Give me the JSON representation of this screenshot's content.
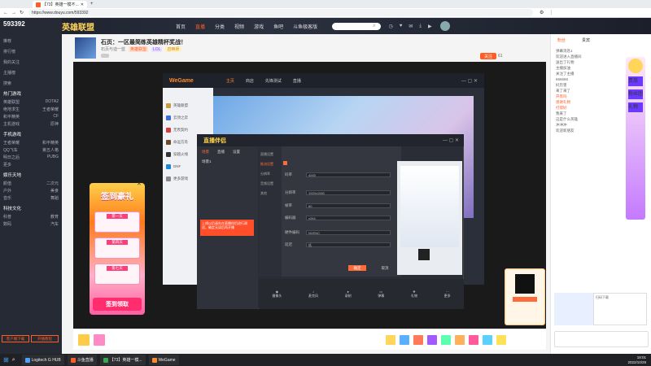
{
  "browser": {
    "tab_title": "【73】英雄一模不...",
    "url": "https://www.douyu.com/593392",
    "page_zoom": "593392"
  },
  "site": {
    "nav": [
      "首页",
      "直播",
      "分类",
      "视频",
      "游戏",
      "鱼吧",
      "斗鱼极客版"
    ],
    "active_nav": "直播"
  },
  "sidebar": {
    "top_items": [
      "推荐",
      "排行榜",
      "我的关注",
      "主播榜",
      "搜索"
    ],
    "sections": [
      {
        "title": "热门游戏",
        "rows": [
          [
            "英雄联盟",
            "DOTA2"
          ],
          [
            "绝地求生",
            "王者荣耀"
          ],
          [
            "和平精英",
            "CF"
          ],
          [
            "主机游戏",
            "原神"
          ]
        ]
      },
      {
        "title": "手机游戏",
        "rows": [
          [
            "王者荣耀",
            "和平精英"
          ],
          [
            "QQ飞车",
            "第五人格"
          ],
          [
            "明日之后",
            "PUBG"
          ],
          [
            "更多",
            ""
          ]
        ]
      },
      {
        "title": "娱乐天地",
        "rows": [
          [
            "颜值",
            "二次元"
          ],
          [
            "户外",
            "美食"
          ],
          [
            "音乐",
            "舞蹈"
          ]
        ]
      },
      {
        "title": "科技文化",
        "rows": [
          [
            "科普",
            "教育"
          ],
          [
            "数码",
            "汽车"
          ]
        ]
      }
    ],
    "bottom_buttons": [
      "客户端下载",
      "开播教程"
    ]
  },
  "room": {
    "title": "石页：一区最简练英雄精杯奖战！",
    "streamer": "石页与迪一蓝",
    "tags": [
      "英雄联盟",
      "LOL",
      "召唤师"
    ],
    "follow_label": "关注",
    "follow_count": "61"
  },
  "player": {
    "wegame": {
      "logo": "WeGame",
      "tabs": [
        "主页",
        "商店",
        "先锋测试",
        "直播"
      ],
      "side_items": [
        "英雄联盟",
        "云顶之弈",
        "无畏契约",
        "命运方舟",
        "穿越火线",
        "DNF",
        "更多游戏"
      ]
    },
    "obs": {
      "title": "直播伴侣",
      "left_tabs": [
        "场景",
        "直播",
        "设置"
      ],
      "left_source": "场景1",
      "settings_nav": [
        "直播设置",
        "推流设置",
        "分辨率",
        "音频设置",
        "其他"
      ],
      "rows": [
        {
          "label": "码率",
          "value": "4000"
        },
        {
          "label": "分辨率",
          "value": "1920x1080"
        },
        {
          "label": "帧率",
          "value": "60"
        },
        {
          "label": "编码器",
          "value": "x264"
        },
        {
          "label": "硬件编码",
          "value": "NVENC"
        },
        {
          "label": "延迟",
          "value": "低"
        }
      ],
      "ok_label": "确定",
      "cancel_label": "取消",
      "bottom_items": [
        "摄像头",
        "麦克风",
        "录制",
        "弹幕",
        "礼物",
        "更多"
      ],
      "alert": "上线以后请先在直播伴侣进行测试，确定无误后再开播"
    }
  },
  "promo": {
    "title": "签到豪礼",
    "days": [
      "第一天",
      "第四天",
      "第七天"
    ],
    "button": "签到领取"
  },
  "right_panel": {
    "tabs": [
      "粉丝",
      "贵宾"
    ],
    "badges": [
      "贵族",
      "粉丝团",
      "礼物"
    ],
    "chat": [
      "弹幕消息1",
      "欢迎进入直播间",
      "送出了礼物",
      "主播加油",
      "关注了主播",
      "666666",
      "好厉害",
      "来了来了",
      "开黑吗",
      "感谢礼物",
      "打得好",
      "我来了",
      "这是什么英雄",
      "冲冲冲",
      "欢迎新朋友"
    ],
    "qr_caption": "扫码下载"
  },
  "taskbar": {
    "items": [
      "Logitech G HUB",
      "斗鱼直播",
      "【73】英雄一模...",
      "WeGame"
    ],
    "time": "18:01",
    "date": "2022/10/29"
  },
  "colors": {
    "brand": "#ff5d23",
    "nav_bg": "#1b1f2b",
    "pink": "#ff5fa2"
  }
}
